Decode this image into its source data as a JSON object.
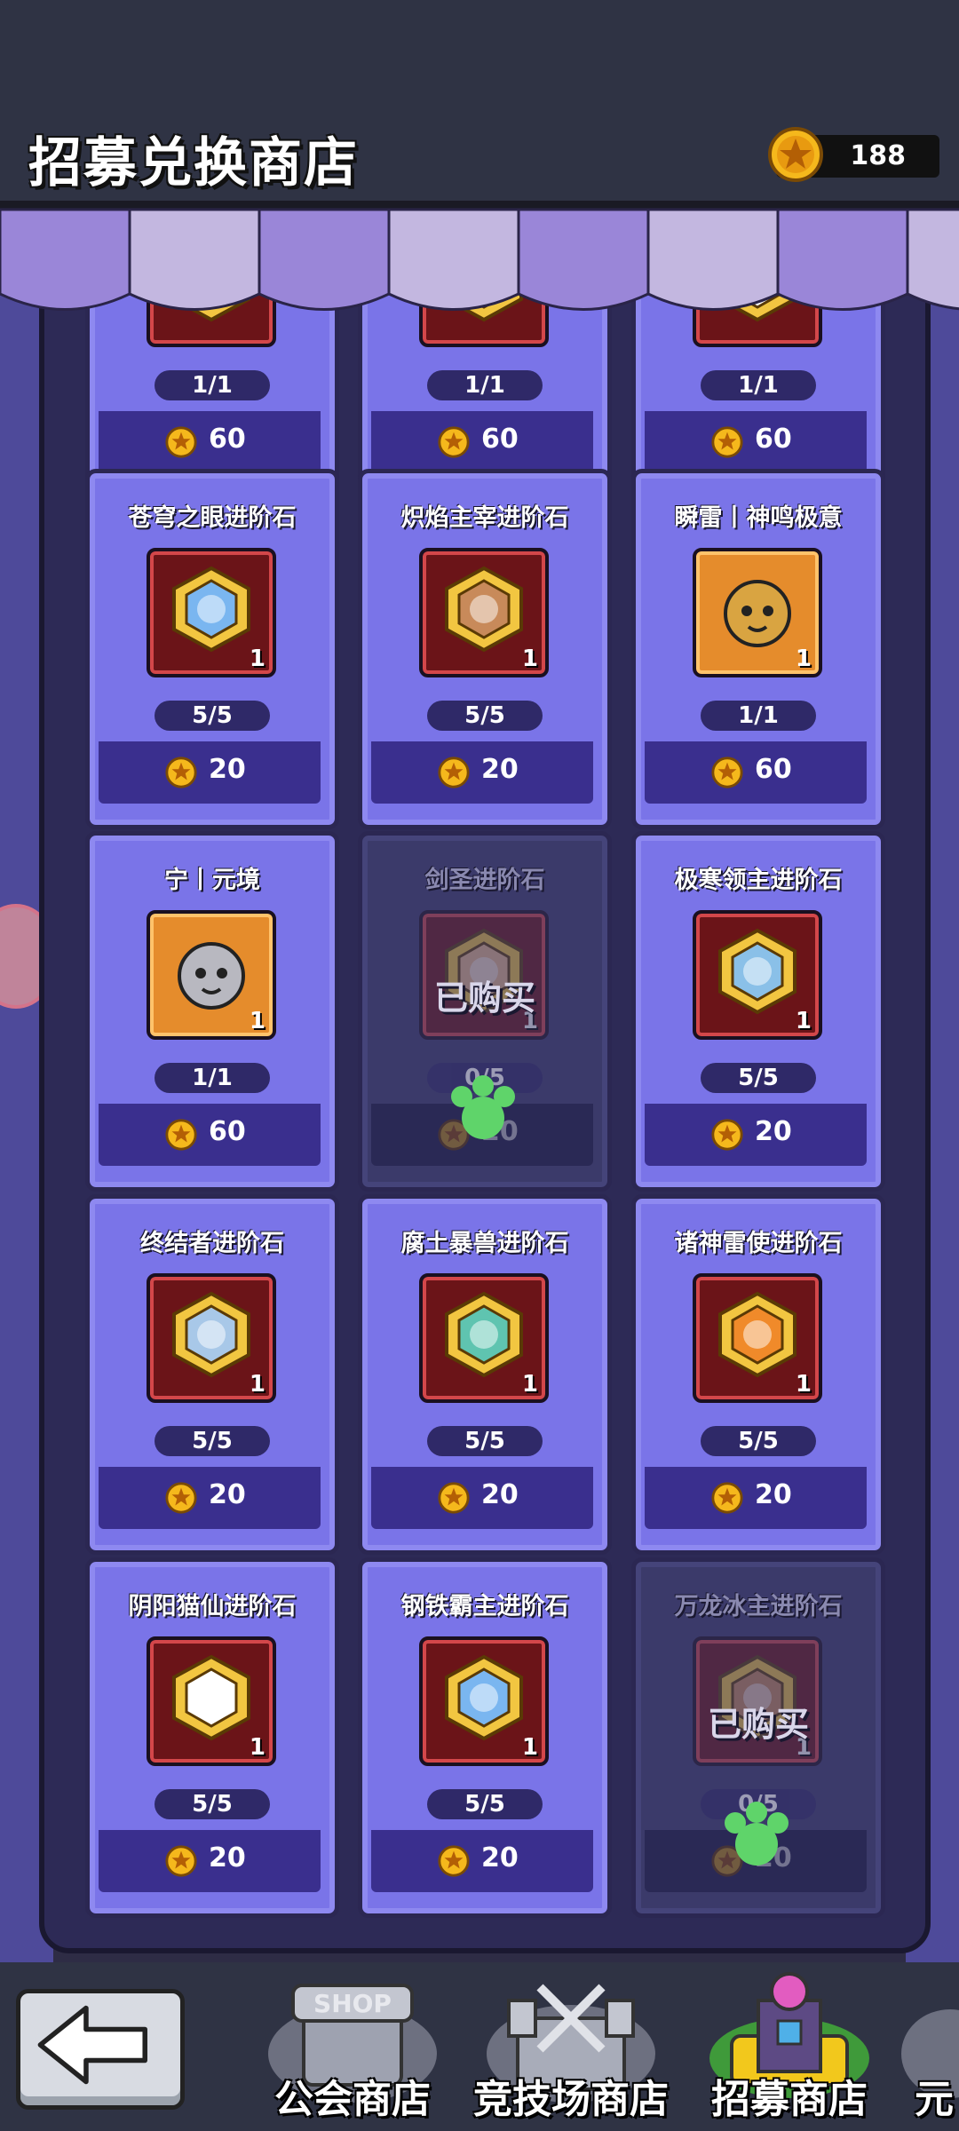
{
  "header": {
    "title": "招募兑换商店",
    "currency_amount": "188"
  },
  "cards": [
    {
      "name": "",
      "stock": "1/1",
      "price": "60",
      "sold": false,
      "icon": "partial-item"
    },
    {
      "name": "",
      "stock": "1/1",
      "price": "60",
      "sold": false,
      "icon": "partial-item"
    },
    {
      "name": "",
      "stock": "1/1",
      "price": "60",
      "sold": false,
      "icon": "partial-item"
    },
    {
      "name": "苍穹之眼进阶石",
      "qty": "1",
      "stock": "5/5",
      "price": "20",
      "sold": false,
      "icon": "hex-stone-gem"
    },
    {
      "name": "炽焰主宰进阶石",
      "qty": "1",
      "stock": "5/5",
      "price": "20",
      "sold": false,
      "icon": "hex-stone-gem"
    },
    {
      "name": "瞬雷丨神鸣极意",
      "qty": "1",
      "stock": "1/1",
      "price": "60",
      "sold": false,
      "icon": "hero-portrait"
    },
    {
      "name": "宁丨元境",
      "qty": "1",
      "stock": "1/1",
      "price": "60",
      "sold": false,
      "icon": "hero-portrait"
    },
    {
      "name": "剑圣进阶石",
      "qty": "1",
      "stock": "0/5",
      "price": "20",
      "sold": true,
      "sold_label": "已购买",
      "icon": "hex-stone-gem"
    },
    {
      "name": "极寒领主进阶石",
      "qty": "1",
      "stock": "5/5",
      "price": "20",
      "sold": false,
      "icon": "hex-stone-gem"
    },
    {
      "name": "终结者进阶石",
      "qty": "1",
      "stock": "5/5",
      "price": "20",
      "sold": false,
      "icon": "hex-stone-gem"
    },
    {
      "name": "腐土暴兽进阶石",
      "qty": "1",
      "stock": "5/5",
      "price": "20",
      "sold": false,
      "icon": "hex-stone-gem"
    },
    {
      "name": "诸神雷使进阶石",
      "qty": "1",
      "stock": "5/5",
      "price": "20",
      "sold": false,
      "icon": "hex-stone-gem"
    },
    {
      "name": "阴阳猫仙进阶石",
      "qty": "1",
      "stock": "5/5",
      "price": "20",
      "sold": false,
      "icon": "hex-stone-gem"
    },
    {
      "name": "钢铁霸主进阶石",
      "qty": "1",
      "stock": "5/5",
      "price": "20",
      "sold": false,
      "icon": "hex-stone-gem"
    },
    {
      "name": "万龙冰主进阶石",
      "qty": "1",
      "stock": "0/5",
      "price": "20",
      "sold": true,
      "sold_label": "已购买",
      "icon": "hex-stone-gem"
    }
  ],
  "bottom_nav": {
    "back_icon": "arrow-left-icon",
    "tabs": [
      {
        "label": "公会商店",
        "badge": "SHOP"
      },
      {
        "label": "竞技场商店"
      },
      {
        "label": "招募商店"
      },
      {
        "label": "元"
      }
    ]
  },
  "colors": {
    "card_bg": "#7a74e8",
    "price_bar": "#3a2f8e",
    "coin": "#f5b81c",
    "shelf": "#2d2a56"
  }
}
